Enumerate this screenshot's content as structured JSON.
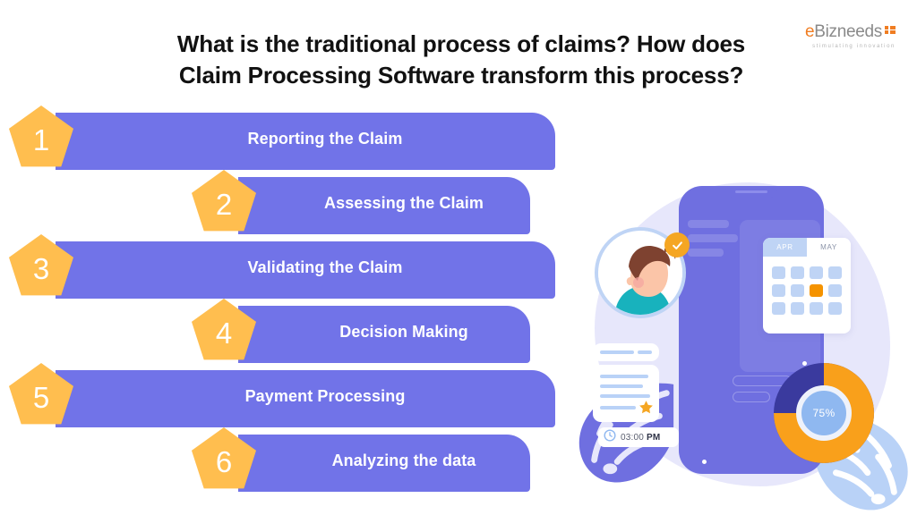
{
  "header": {
    "title_line1": "What is the traditional process of claims? How does",
    "title_line2": "Claim Processing Software transform this process?"
  },
  "logo": {
    "word_e": "e",
    "word_rest": "Bizneeds",
    "tagline": "stimulating innovation"
  },
  "colors": {
    "banner_purple": "#7173e8",
    "pentagon_orange": "#ffbe4f",
    "brand_orange": "#f07d22",
    "accent_blue": "#bfd4f5",
    "donut_orange": "#f9a01b",
    "donut_navy": "#3a3a9e",
    "blob_lavender": "#e7e7fb"
  },
  "steps": [
    {
      "number": "1",
      "label": "Reporting the Claim",
      "indent": false
    },
    {
      "number": "2",
      "label": "Assessing the Claim",
      "indent": true
    },
    {
      "number": "3",
      "label": "Validating the Claim",
      "indent": false
    },
    {
      "number": "4",
      "label": "Decision Making",
      "indent": true
    },
    {
      "number": "5",
      "label": "Payment Processing",
      "indent": false
    },
    {
      "number": "6",
      "label": "Analyzing the data",
      "indent": true
    }
  ],
  "illustration": {
    "calendar": {
      "tab_active": "APR",
      "tab_inactive": "MAY",
      "cells": 12,
      "highlighted_cell_index": 6
    },
    "donut": {
      "label": "75%",
      "percent": 75
    },
    "time_chip": {
      "time": "03:00",
      "meridiem": "PM"
    }
  }
}
